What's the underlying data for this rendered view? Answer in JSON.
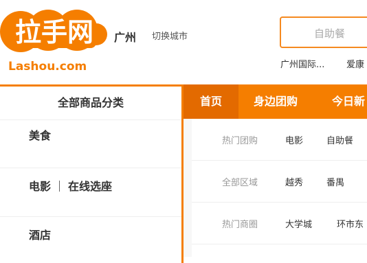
{
  "header": {
    "logo": {
      "text": "拉手网",
      "sub": "Lashou.com",
      "brand_color": "#f57e00"
    },
    "city": "广州",
    "switch_city": "切换城市",
    "search": {
      "placeholder": "自助餐"
    },
    "hot_links": [
      "广州国际...",
      "爱康"
    ]
  },
  "category_panel": {
    "title": "全部商品分类",
    "items": [
      {
        "label": "美食"
      },
      {
        "label_a": "电影",
        "label_b": "在线选座"
      },
      {
        "label": "酒店"
      }
    ]
  },
  "nav": {
    "items": [
      "首页",
      "身边团购",
      "今日新"
    ]
  },
  "rows": [
    {
      "label": "热门团购",
      "links": [
        "电影",
        "自助餐"
      ]
    },
    {
      "label": "全部区域",
      "links": [
        "越秀",
        "番禺"
      ]
    },
    {
      "label": "热门商圈",
      "links": [
        "大学城",
        "环市东"
      ]
    }
  ],
  "colors": {
    "accent": "#f57e00",
    "accent_dark": "#e36a00",
    "border": "#eeeeee"
  }
}
